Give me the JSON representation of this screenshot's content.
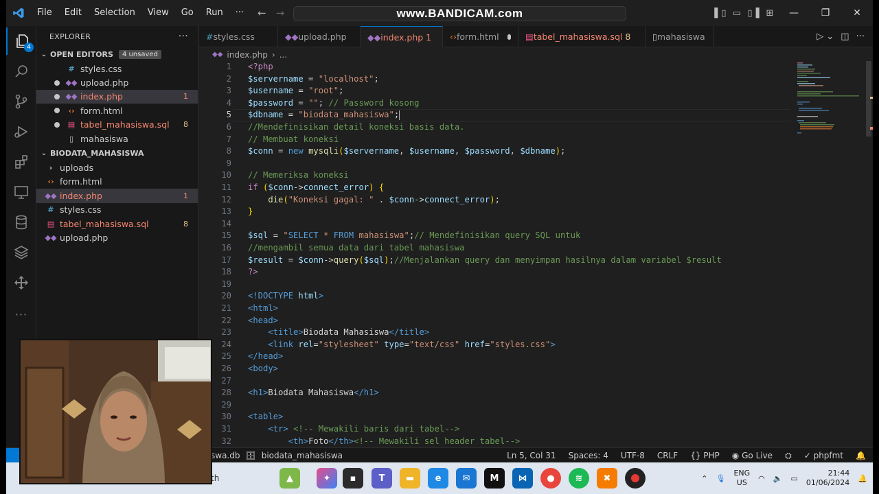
{
  "watermark": "www.BANDICAM.com",
  "menu": [
    "File",
    "Edit",
    "Selection",
    "View",
    "Go",
    "Run",
    "···"
  ],
  "activity_badge": "4",
  "explorer": {
    "title": "EXPLORER",
    "open_editors_label": "OPEN EDITORS",
    "unsaved_badge": "4 unsaved",
    "open_editors": [
      {
        "name": "styles.css",
        "icon": "#",
        "kind": "css",
        "dot": false,
        "count": ""
      },
      {
        "name": "upload.php",
        "icon": "php",
        "kind": "php",
        "dot": true,
        "count": ""
      },
      {
        "name": "index.php",
        "icon": "php",
        "kind": "php",
        "dot": true,
        "count": "1",
        "status": "error",
        "selected": true
      },
      {
        "name": "form.html",
        "icon": "<>",
        "kind": "html",
        "dot": true,
        "count": ""
      },
      {
        "name": "tabel_mahasiswa.sql",
        "icon": "db",
        "kind": "sql",
        "dot": true,
        "count": "8",
        "status": "warn"
      },
      {
        "name": "mahasiswa",
        "icon": "file",
        "kind": "plain",
        "dot": false,
        "count": ""
      }
    ],
    "folder_label": "BIODATA_MAHASISWA",
    "folder": [
      {
        "name": "uploads",
        "icon": ">",
        "kind": "folder",
        "count": ""
      },
      {
        "name": "form.html",
        "icon": "<>",
        "kind": "html",
        "count": ""
      },
      {
        "name": "index.php",
        "icon": "php",
        "kind": "php",
        "count": "1",
        "status": "error",
        "selected": true
      },
      {
        "name": "styles.css",
        "icon": "#",
        "kind": "css",
        "count": ""
      },
      {
        "name": "tabel_mahasiswa.sql",
        "icon": "db",
        "kind": "sql",
        "count": "8",
        "status": "warn"
      },
      {
        "name": "upload.php",
        "icon": "php",
        "kind": "php",
        "count": ""
      }
    ]
  },
  "tabs": [
    {
      "name": "styles.css",
      "icon": "#",
      "kind": "css",
      "dot": false,
      "count": ""
    },
    {
      "name": "upload.php",
      "icon": "php",
      "kind": "php",
      "dot": true,
      "count": ""
    },
    {
      "name": "index.php",
      "icon": "php",
      "kind": "php",
      "dot": true,
      "count": "1",
      "active": true
    },
    {
      "name": "form.html",
      "icon": "<>",
      "kind": "html",
      "dot": true,
      "count": ""
    },
    {
      "name": "tabel_mahasiswa.sql",
      "icon": "db",
      "kind": "sql",
      "dot": true,
      "count": "8"
    },
    {
      "name": "mahasiswa",
      "icon": "file",
      "kind": "plain",
      "dot": false,
      "count": ""
    }
  ],
  "breadcrumb": {
    "file": "index.php",
    "rest": "..."
  },
  "current_line": 5,
  "code": [
    [
      [
        "t-ctl",
        "<?php"
      ]
    ],
    [
      [
        "t-var",
        "$servername"
      ],
      [
        "t-plain",
        " = "
      ],
      [
        "t-str",
        "\"localhost\""
      ],
      [
        "t-plain",
        ";"
      ]
    ],
    [
      [
        "t-var",
        "$username"
      ],
      [
        "t-plain",
        " = "
      ],
      [
        "t-str",
        "\"root\""
      ],
      [
        "t-plain",
        ";"
      ]
    ],
    [
      [
        "t-var",
        "$password"
      ],
      [
        "t-plain",
        " = "
      ],
      [
        "t-str",
        "\"\""
      ],
      [
        "t-plain",
        "; "
      ],
      [
        "t-com",
        "// Password kosong"
      ]
    ],
    [
      [
        "t-var",
        "$dbname"
      ],
      [
        "t-plain",
        " = "
      ],
      [
        "t-str",
        "\"biodata_mahasiswa\""
      ],
      [
        "t-plain",
        ";"
      ]
    ],
    [
      [
        "t-com",
        "//Mendefinisikan detail koneksi basis data."
      ]
    ],
    [
      [
        "t-com",
        "// Membuat koneksi"
      ]
    ],
    [
      [
        "t-var",
        "$conn"
      ],
      [
        "t-plain",
        " = "
      ],
      [
        "t-kw",
        "new "
      ],
      [
        "t-fn",
        "mysqli"
      ],
      [
        "t-br",
        "("
      ],
      [
        "t-var",
        "$servername"
      ],
      [
        "t-plain",
        ", "
      ],
      [
        "t-var",
        "$username"
      ],
      [
        "t-plain",
        ", "
      ],
      [
        "t-var",
        "$password"
      ],
      [
        "t-plain",
        ", "
      ],
      [
        "t-var",
        "$dbname"
      ],
      [
        "t-br",
        ")"
      ],
      [
        "t-plain",
        ";"
      ]
    ],
    [],
    [
      [
        "t-com",
        "// Memeriksa koneksi"
      ]
    ],
    [
      [
        "t-ctl",
        "if "
      ],
      [
        "t-br",
        "("
      ],
      [
        "t-var",
        "$conn"
      ],
      [
        "t-plain",
        "->"
      ],
      [
        "t-var",
        "connect_error"
      ],
      [
        "t-br",
        ")"
      ],
      [
        "t-plain",
        " "
      ],
      [
        "t-br",
        "{"
      ]
    ],
    [
      [
        "t-plain",
        "    "
      ],
      [
        "t-fn",
        "die"
      ],
      [
        "t-br",
        "("
      ],
      [
        "t-str",
        "\"Koneksi gagal: \""
      ],
      [
        "t-plain",
        " . "
      ],
      [
        "t-var",
        "$conn"
      ],
      [
        "t-plain",
        "->"
      ],
      [
        "t-var",
        "connect_error"
      ],
      [
        "t-br",
        ")"
      ],
      [
        "t-plain",
        ";"
      ]
    ],
    [
      [
        "t-br",
        "}"
      ]
    ],
    [],
    [
      [
        "t-var",
        "$sql"
      ],
      [
        "t-plain",
        " = "
      ],
      [
        "t-str",
        "\""
      ],
      [
        "t-kw",
        "SELECT"
      ],
      [
        "t-str",
        " * "
      ],
      [
        "t-kw",
        "FROM"
      ],
      [
        "t-str",
        " mahasiswa\""
      ],
      [
        "t-plain",
        ";"
      ],
      [
        "t-com",
        "// Mendefinisikan query SQL untuk"
      ]
    ],
    [
      [
        "t-com",
        "//mengambil semua data dari tabel mahasiswa"
      ]
    ],
    [
      [
        "t-var",
        "$result"
      ],
      [
        "t-plain",
        " = "
      ],
      [
        "t-var",
        "$conn"
      ],
      [
        "t-plain",
        "->"
      ],
      [
        "t-fn",
        "query"
      ],
      [
        "t-br",
        "("
      ],
      [
        "t-var",
        "$sql"
      ],
      [
        "t-br",
        ")"
      ],
      [
        "t-plain",
        ";"
      ],
      [
        "t-com",
        "//Menjalankan query dan menyimpan hasilnya dalam variabel $result"
      ]
    ],
    [
      [
        "t-ctl",
        "?>"
      ]
    ],
    [],
    [
      [
        "t-tag",
        "<!DOCTYPE "
      ],
      [
        "t-attr",
        "html"
      ],
      [
        "t-tag",
        ">"
      ]
    ],
    [
      [
        "t-tag",
        "<html>"
      ]
    ],
    [
      [
        "t-tag",
        "<head>"
      ]
    ],
    [
      [
        "t-plain",
        "    "
      ],
      [
        "t-tag",
        "<title>"
      ],
      [
        "t-plain",
        "Biodata Mahasiswa"
      ],
      [
        "t-tag",
        "</title>"
      ]
    ],
    [
      [
        "t-plain",
        "    "
      ],
      [
        "t-tag",
        "<link "
      ],
      [
        "t-attr",
        "rel"
      ],
      [
        "t-plain",
        "="
      ],
      [
        "t-str",
        "\"stylesheet\""
      ],
      [
        "t-plain",
        " "
      ],
      [
        "t-attr",
        "type"
      ],
      [
        "t-plain",
        "="
      ],
      [
        "t-str",
        "\"text/css\""
      ],
      [
        "t-plain",
        " "
      ],
      [
        "t-attr",
        "href"
      ],
      [
        "t-plain",
        "="
      ],
      [
        "t-str",
        "\"styles.css\""
      ],
      [
        "t-tag",
        ">"
      ]
    ],
    [
      [
        "t-tag",
        "</head>"
      ]
    ],
    [
      [
        "t-tag",
        "<body>"
      ]
    ],
    [],
    [
      [
        "t-tag",
        "<h1>"
      ],
      [
        "t-plain",
        "Biodata Mahasiswa"
      ],
      [
        "t-tag",
        "</h1>"
      ]
    ],
    [],
    [
      [
        "t-tag",
        "<table>"
      ]
    ],
    [
      [
        "t-plain",
        "    "
      ],
      [
        "t-tag",
        "<tr>"
      ],
      [
        "t-plain",
        " "
      ],
      [
        "t-com",
        "<!-- Mewakili baris dari tabel-->"
      ]
    ],
    [
      [
        "t-plain",
        "        "
      ],
      [
        "t-tag",
        "<th>"
      ],
      [
        "t-plain",
        "Foto"
      ],
      [
        "t-tag",
        "</th>"
      ],
      [
        "t-com",
        "<!-- Mewakili sel header tabel-->"
      ]
    ]
  ],
  "status": {
    "db": "swa.db",
    "schema": "biodata_mahasiswa",
    "position": "Ln 5, Col 31",
    "spaces": "Spaces: 4",
    "encoding": "UTF-8",
    "eol": "CRLF",
    "language": "PHP",
    "golive": "Go Live",
    "formatter": "phpfmt"
  },
  "taskbar": {
    "search": "th",
    "lang_top": "ENG",
    "lang_bottom": "US",
    "time": "21:44",
    "date": "01/06/2024"
  }
}
